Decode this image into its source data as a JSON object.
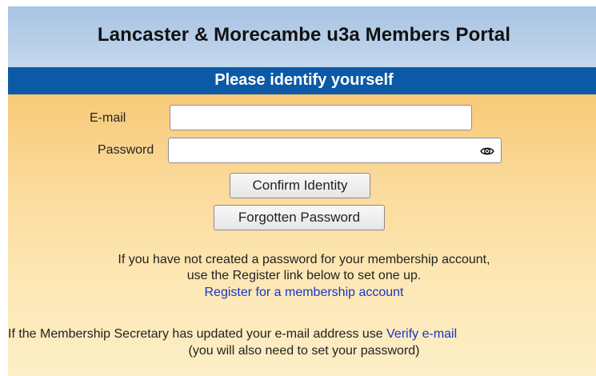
{
  "header": {
    "title": "Lancaster & Morecambe u3a Members Portal"
  },
  "banner": {
    "title": "Please identify yourself"
  },
  "form": {
    "email_label": "E-mail",
    "email_value": "",
    "password_label": "Password",
    "password_value": "",
    "password_toggle_icon": "eye-icon",
    "confirm_label": "Confirm Identity",
    "forgot_label": "Forgotten Password"
  },
  "info": {
    "line1": "If you have not created a password for your membership account,",
    "line2": "use the Register link below to set one up.",
    "register_link": "Register for a membership account",
    "verify_text": "If the Membership Secretary has updated your e-mail address use",
    "verify_link": "Verify e-mail",
    "verify_note": "(you will also need to set your password)"
  },
  "colors": {
    "header_bg": "#b8cfe8",
    "banner_bg": "#0c5aa6",
    "content_bg_top": "#f7c978",
    "content_bg_bottom": "#fceec6",
    "link": "#1a35c8"
  }
}
